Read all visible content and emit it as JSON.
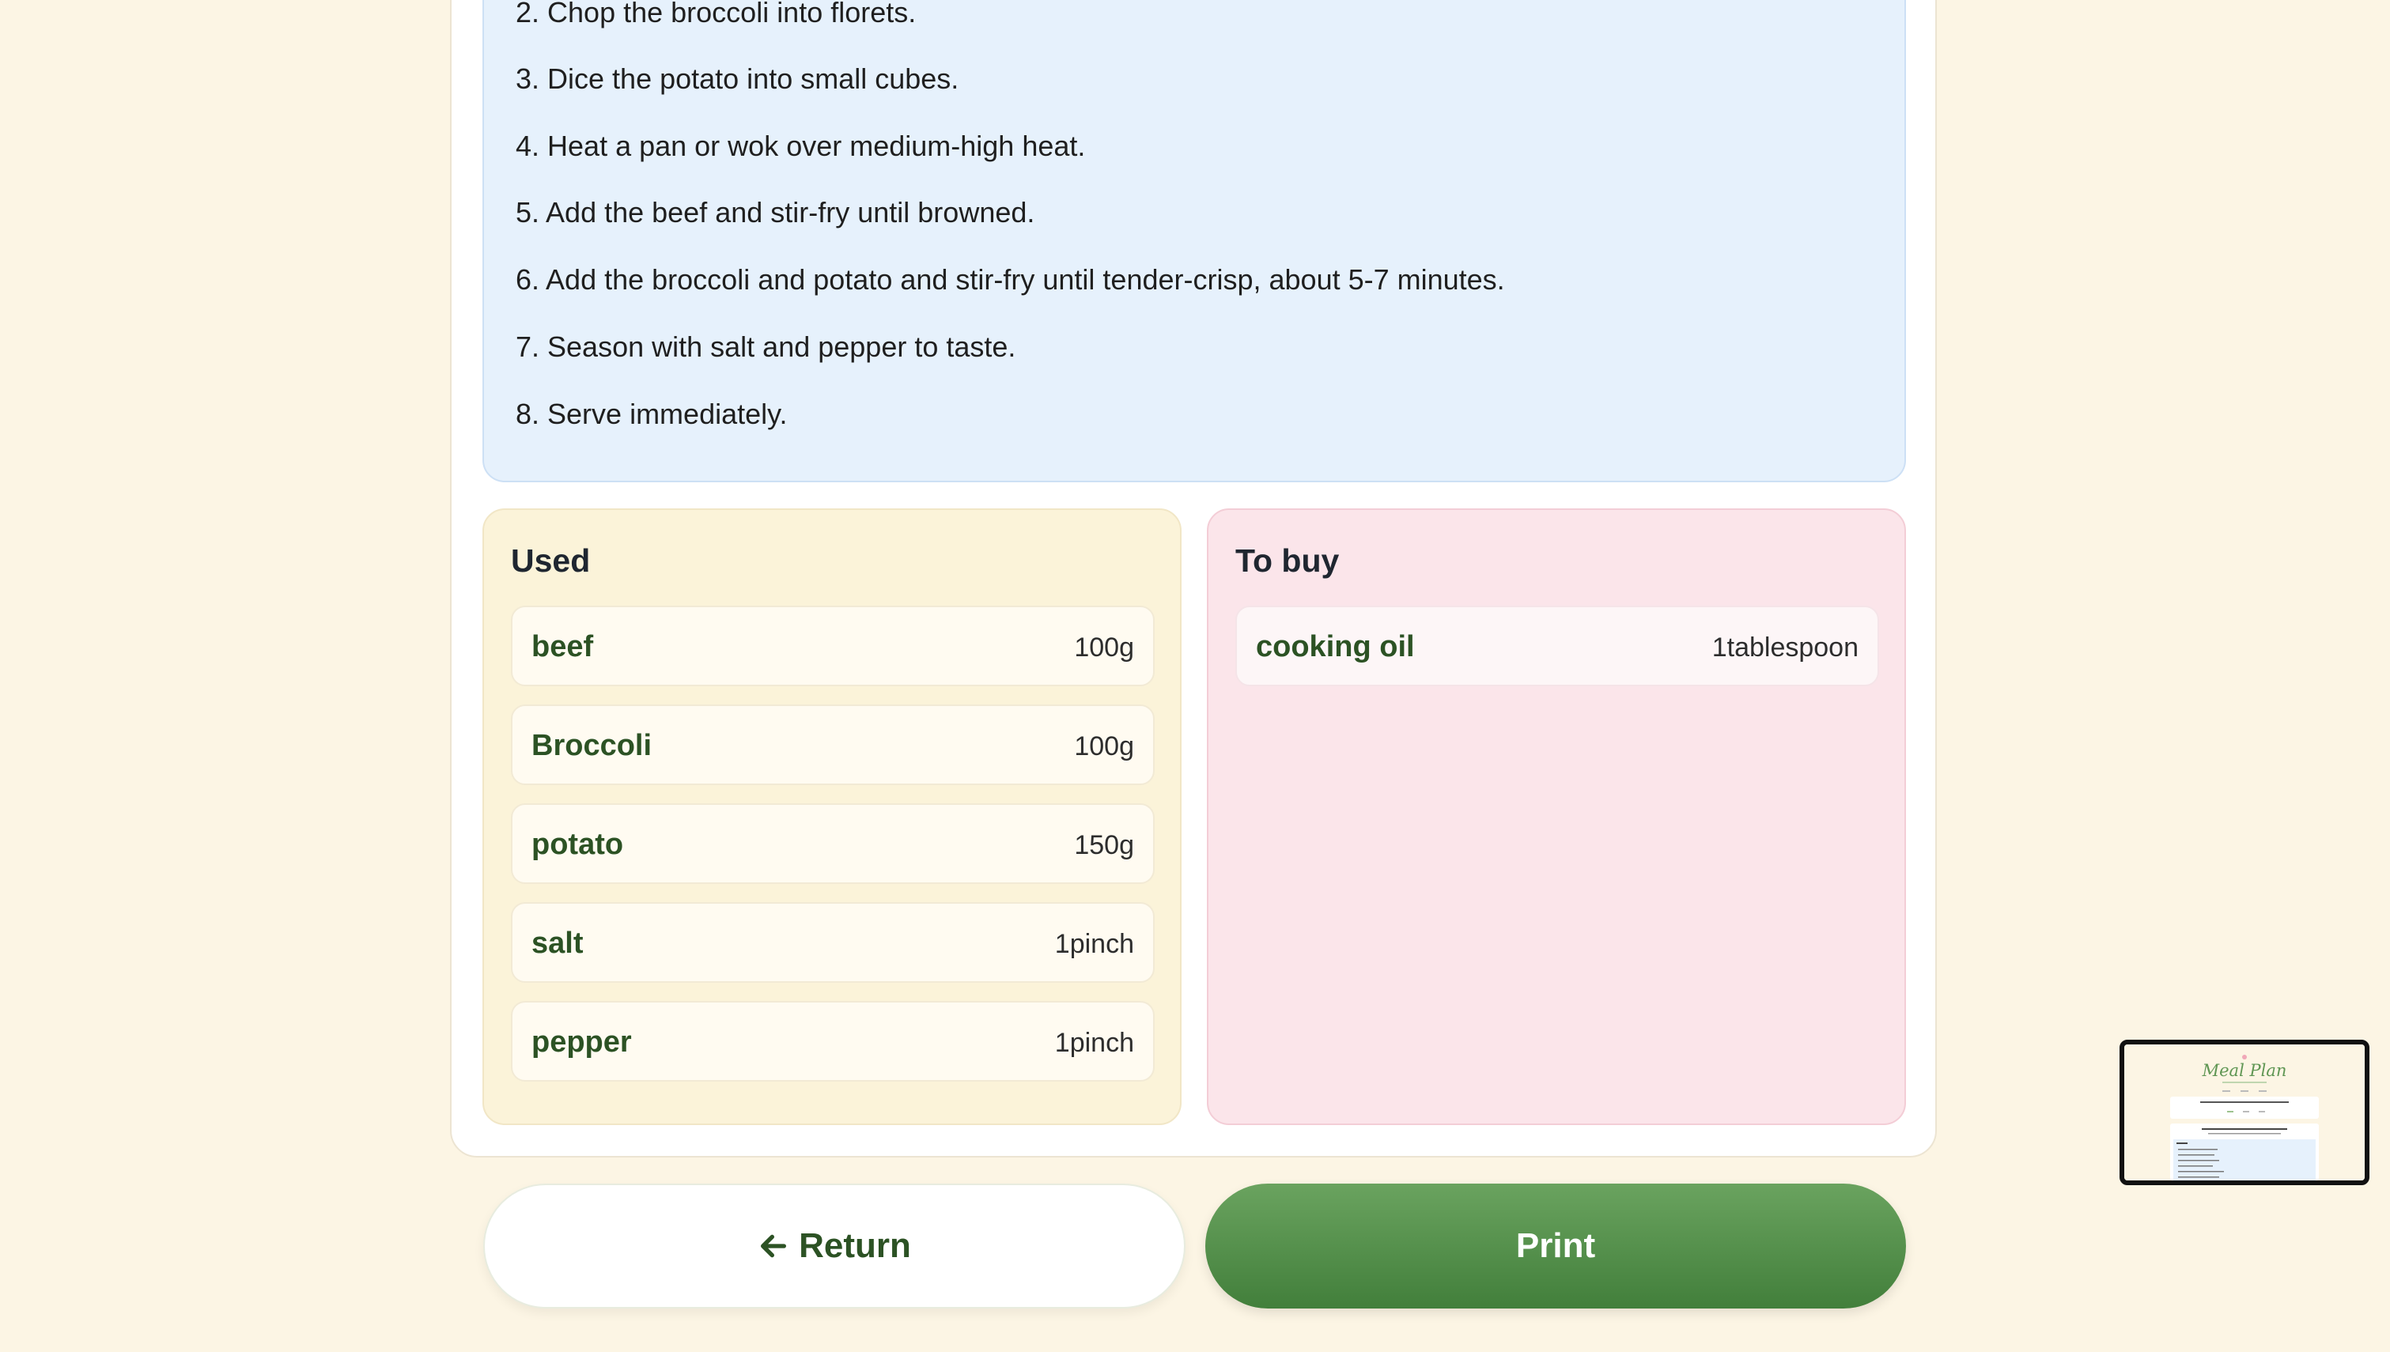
{
  "steps": [
    "2. Chop the broccoli into florets.",
    "3. Dice the potato into small cubes.",
    "4. Heat a pan or wok over medium-high heat.",
    "5. Add the beef and stir-fry until browned.",
    "6. Add the broccoli and potato and stir-fry until tender-crisp, about 5-7 minutes.",
    "7. Season with salt and pepper to taste.",
    "8. Serve immediately."
  ],
  "used": {
    "title": "Used",
    "items": [
      {
        "name": "beef",
        "qty": "100g"
      },
      {
        "name": "Broccoli",
        "qty": "100g"
      },
      {
        "name": "potato",
        "qty": "150g"
      },
      {
        "name": "salt",
        "qty": "1pinch"
      },
      {
        "name": "pepper",
        "qty": "1pinch"
      }
    ]
  },
  "to_buy": {
    "title": "To buy",
    "items": [
      {
        "name": "cooking oil",
        "qty": "1tablespoon"
      }
    ]
  },
  "buttons": {
    "return_label": "Return",
    "print_label": "Print"
  },
  "thumbnail": {
    "title": "Meal Plan"
  },
  "colors": {
    "page_bg": "#fcf5e4",
    "steps_bg": "#e6f1fc",
    "used_bg": "#fbf3d9",
    "to_buy_bg": "#fbe5ea",
    "accent_green": "#2c5224",
    "print_button": "#4f8c47"
  },
  "icons": {
    "return": "arrow-left-icon"
  }
}
